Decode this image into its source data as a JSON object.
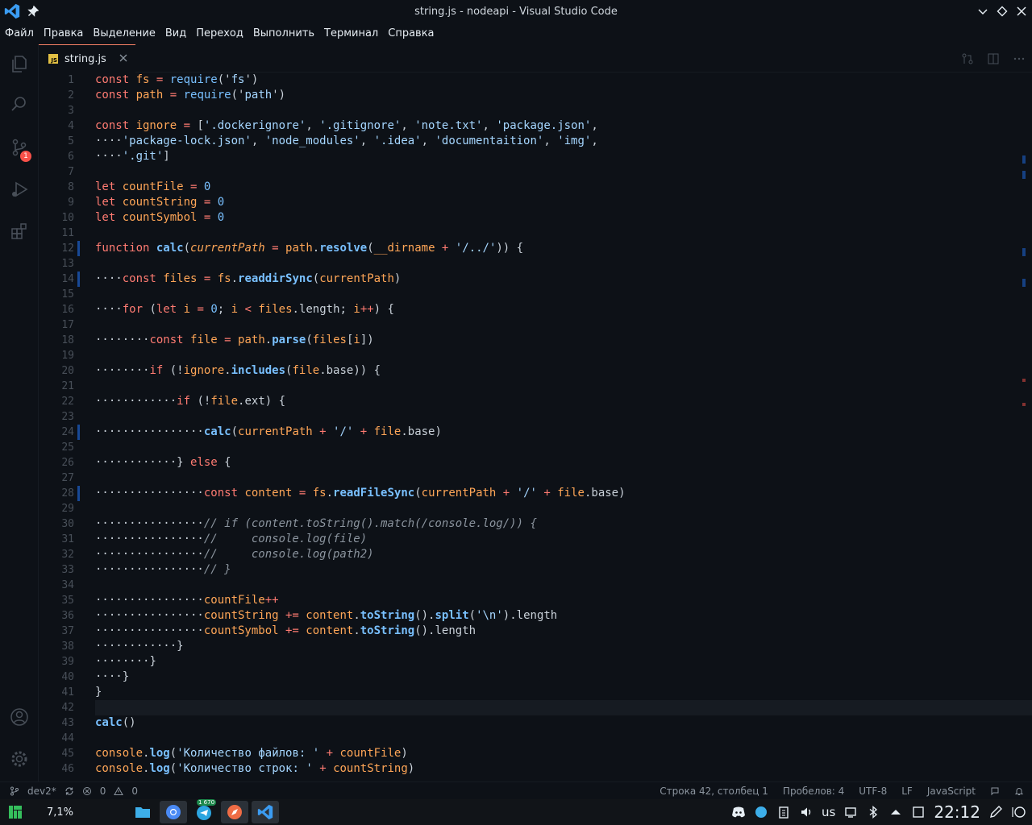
{
  "window": {
    "title": "string.js - nodeapi - Visual Studio Code"
  },
  "menu": [
    "Файл",
    "Правка",
    "Выделение",
    "Вид",
    "Переход",
    "Выполнить",
    "Терминал",
    "Справка"
  ],
  "activity": {
    "items": [
      "explorer-icon",
      "search-icon",
      "source-control-icon",
      "run-debug-icon",
      "extensions-icon",
      "account-icon",
      "settings-gear-icon"
    ],
    "scm_badge": "1"
  },
  "tab": {
    "label": "string.js",
    "icon_text": "JS"
  },
  "editor": {
    "current_line": 42,
    "lines": [
      [
        [
          "const ",
          "kw"
        ],
        [
          "fs",
          "var"
        ],
        [
          " = ",
          "op"
        ],
        [
          "require",
          "fn2"
        ],
        [
          "('",
          "pl"
        ],
        [
          "fs",
          "str"
        ],
        [
          "')",
          "pl"
        ]
      ],
      [
        [
          "const ",
          "kw"
        ],
        [
          "path",
          "var"
        ],
        [
          " = ",
          "op"
        ],
        [
          "require",
          "fn2"
        ],
        [
          "('",
          "pl"
        ],
        [
          "path",
          "str"
        ],
        [
          "')",
          "pl"
        ]
      ],
      [],
      [
        [
          "const ",
          "kw"
        ],
        [
          "ignore",
          "var"
        ],
        [
          " = ",
          "op"
        ],
        [
          "[",
          "pl"
        ],
        [
          "'.dockerignore'",
          "str"
        ],
        [
          ", ",
          "pl"
        ],
        [
          "'.gitignore'",
          "str"
        ],
        [
          ", ",
          "pl"
        ],
        [
          "'note.txt'",
          "str"
        ],
        [
          ", ",
          "pl"
        ],
        [
          "'package.json'",
          "str"
        ],
        [
          ",",
          "pl"
        ]
      ],
      [
        [
          "····",
          "ws"
        ],
        [
          "'package-lock.json'",
          "str"
        ],
        [
          ", ",
          "pl"
        ],
        [
          "'node_modules'",
          "str"
        ],
        [
          ", ",
          "pl"
        ],
        [
          "'.idea'",
          "str"
        ],
        [
          ", ",
          "pl"
        ],
        [
          "'documentaition'",
          "str"
        ],
        [
          ", ",
          "pl"
        ],
        [
          "'img'",
          "str"
        ],
        [
          ",",
          "pl"
        ]
      ],
      [
        [
          "····",
          "ws"
        ],
        [
          "'.git'",
          "str"
        ],
        [
          "]",
          "pl"
        ]
      ],
      [],
      [
        [
          "let ",
          "kw"
        ],
        [
          "countFile",
          "var"
        ],
        [
          " = ",
          "op"
        ],
        [
          "0",
          "num"
        ]
      ],
      [
        [
          "let ",
          "kw"
        ],
        [
          "countString",
          "var"
        ],
        [
          " = ",
          "op"
        ],
        [
          "0",
          "num"
        ]
      ],
      [
        [
          "let ",
          "kw"
        ],
        [
          "countSymbol",
          "var"
        ],
        [
          " = ",
          "op"
        ],
        [
          "0",
          "num"
        ]
      ],
      [],
      [
        [
          "function ",
          "kw"
        ],
        [
          "calc",
          "fn"
        ],
        [
          "(",
          "pl"
        ],
        [
          "currentPath",
          "it"
        ],
        [
          " = ",
          "op"
        ],
        [
          "path",
          "var"
        ],
        [
          ".",
          "pl"
        ],
        [
          "resolve",
          "fn"
        ],
        [
          "(",
          "pl"
        ],
        [
          "__dirname",
          "var"
        ],
        [
          " + ",
          "op"
        ],
        [
          "'/../'",
          "str"
        ],
        [
          ")) {",
          "pl"
        ]
      ],
      [],
      [
        [
          "····",
          "ws"
        ],
        [
          "const ",
          "kw"
        ],
        [
          "files",
          "var"
        ],
        [
          " = ",
          "op"
        ],
        [
          "fs",
          "var"
        ],
        [
          ".",
          "pl"
        ],
        [
          "readdirSync",
          "fn"
        ],
        [
          "(",
          "pl"
        ],
        [
          "currentPath",
          "var"
        ],
        [
          ")",
          "pl"
        ]
      ],
      [],
      [
        [
          "····",
          "ws"
        ],
        [
          "for ",
          "kw"
        ],
        [
          "(",
          "pl"
        ],
        [
          "let ",
          "kw"
        ],
        [
          "i",
          "var"
        ],
        [
          " = ",
          "op"
        ],
        [
          "0",
          "num"
        ],
        [
          "; ",
          "pl"
        ],
        [
          "i",
          "var"
        ],
        [
          " < ",
          "op"
        ],
        [
          "files",
          "var"
        ],
        [
          ".length; ",
          "pl"
        ],
        [
          "i",
          "var"
        ],
        [
          "++",
          "op"
        ],
        [
          ") {",
          "pl"
        ]
      ],
      [],
      [
        [
          "········",
          "ws"
        ],
        [
          "const ",
          "kw"
        ],
        [
          "file",
          "var"
        ],
        [
          " = ",
          "op"
        ],
        [
          "path",
          "var"
        ],
        [
          ".",
          "pl"
        ],
        [
          "parse",
          "fn"
        ],
        [
          "(",
          "pl"
        ],
        [
          "files",
          "var"
        ],
        [
          "[",
          "pl"
        ],
        [
          "i",
          "var"
        ],
        [
          "])",
          "pl"
        ]
      ],
      [],
      [
        [
          "········",
          "ws"
        ],
        [
          "if ",
          "kw"
        ],
        [
          "(!",
          "pl"
        ],
        [
          "ignore",
          "var"
        ],
        [
          ".",
          "pl"
        ],
        [
          "includes",
          "fn"
        ],
        [
          "(",
          "pl"
        ],
        [
          "file",
          "var"
        ],
        [
          ".base)) {",
          "pl"
        ]
      ],
      [],
      [
        [
          "············",
          "ws"
        ],
        [
          "if ",
          "kw"
        ],
        [
          "(!",
          "pl"
        ],
        [
          "file",
          "var"
        ],
        [
          ".ext) {",
          "pl"
        ]
      ],
      [],
      [
        [
          "················",
          "ws"
        ],
        [
          "calc",
          "fn"
        ],
        [
          "(",
          "pl"
        ],
        [
          "currentPath",
          "var"
        ],
        [
          " + ",
          "op"
        ],
        [
          "'/'",
          "str"
        ],
        [
          " + ",
          "op"
        ],
        [
          "file",
          "var"
        ],
        [
          ".base)",
          "pl"
        ]
      ],
      [],
      [
        [
          "············",
          "ws"
        ],
        [
          "} ",
          "pl"
        ],
        [
          "else ",
          "kw"
        ],
        [
          "{",
          "pl"
        ]
      ],
      [],
      [
        [
          "················",
          "ws"
        ],
        [
          "const ",
          "kw"
        ],
        [
          "content",
          "var"
        ],
        [
          " = ",
          "op"
        ],
        [
          "fs",
          "var"
        ],
        [
          ".",
          "pl"
        ],
        [
          "readFileSync",
          "fn"
        ],
        [
          "(",
          "pl"
        ],
        [
          "currentPath",
          "var"
        ],
        [
          " + ",
          "op"
        ],
        [
          "'/'",
          "str"
        ],
        [
          " + ",
          "op"
        ],
        [
          "file",
          "var"
        ],
        [
          ".base)",
          "pl"
        ]
      ],
      [],
      [
        [
          "················",
          "ws"
        ],
        [
          "// if (content.toString().match(/console.log/)) {",
          "cm"
        ]
      ],
      [
        [
          "················",
          "ws"
        ],
        [
          "//     console.log(file)",
          "cm"
        ]
      ],
      [
        [
          "················",
          "ws"
        ],
        [
          "//     console.log(path2)",
          "cm"
        ]
      ],
      [
        [
          "················",
          "ws"
        ],
        [
          "// }",
          "cm"
        ]
      ],
      [],
      [
        [
          "················",
          "ws"
        ],
        [
          "countFile",
          "var"
        ],
        [
          "++",
          "op"
        ]
      ],
      [
        [
          "················",
          "ws"
        ],
        [
          "countString",
          "var"
        ],
        [
          " += ",
          "op"
        ],
        [
          "content",
          "var"
        ],
        [
          ".",
          "pl"
        ],
        [
          "toString",
          "fn"
        ],
        [
          "().",
          "pl"
        ],
        [
          "split",
          "fn"
        ],
        [
          "(",
          "pl"
        ],
        [
          "'\\n'",
          "str"
        ],
        [
          ").length",
          "pl"
        ]
      ],
      [
        [
          "················",
          "ws"
        ],
        [
          "countSymbol",
          "var"
        ],
        [
          " += ",
          "op"
        ],
        [
          "content",
          "var"
        ],
        [
          ".",
          "pl"
        ],
        [
          "toString",
          "fn"
        ],
        [
          "().length",
          "pl"
        ]
      ],
      [
        [
          "············",
          "ws"
        ],
        [
          "}",
          "pl"
        ]
      ],
      [
        [
          "········",
          "ws"
        ],
        [
          "}",
          "pl"
        ]
      ],
      [
        [
          "····",
          "ws"
        ],
        [
          "}",
          "pl"
        ]
      ],
      [
        [
          "}",
          "pl"
        ]
      ],
      [],
      [
        [
          "calc",
          "fn"
        ],
        [
          "()",
          "pl"
        ]
      ],
      [],
      [
        [
          "console",
          "var"
        ],
        [
          ".",
          "pl"
        ],
        [
          "log",
          "fn"
        ],
        [
          "(",
          "pl"
        ],
        [
          "'Количество файлов: '",
          "str"
        ],
        [
          " + ",
          "op"
        ],
        [
          "countFile",
          "var"
        ],
        [
          ")",
          "pl"
        ]
      ],
      [
        [
          "console",
          "var"
        ],
        [
          ".",
          "pl"
        ],
        [
          "log",
          "fn"
        ],
        [
          "(",
          "pl"
        ],
        [
          "'Количество строк: '",
          "str"
        ],
        [
          " + ",
          "op"
        ],
        [
          "countString",
          "var"
        ],
        [
          ")",
          "pl"
        ]
      ]
    ]
  },
  "status": {
    "branch": "dev2*",
    "errors": "0",
    "warnings": "0",
    "position": "Строка 42, столбец 1",
    "indent": "Пробелов: 4",
    "encoding": "UTF-8",
    "eol": "LF",
    "language": "JavaScript"
  },
  "taskbar": {
    "cpu": "7,1%",
    "telegram_badge": "1 670",
    "lang": "us",
    "clock": "22:12"
  }
}
